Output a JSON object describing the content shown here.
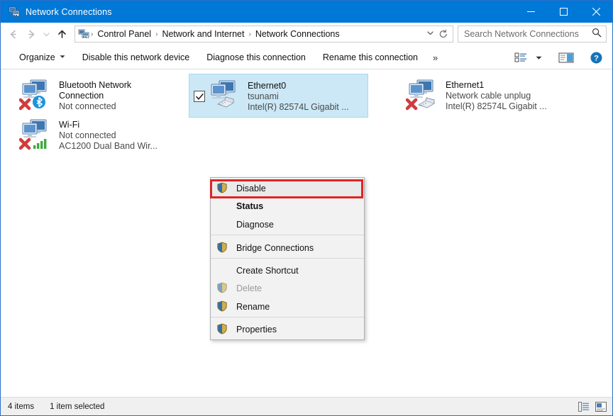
{
  "window": {
    "title": "Network Connections",
    "title_icon": "network-connections-icon",
    "minimize_label": "Minimize",
    "maximize_label": "Maximize",
    "close_label": "Close"
  },
  "nav": {
    "back_icon": "back-arrow-icon",
    "forward_icon": "forward-arrow-icon",
    "history_icon": "recent-locations-chevron-icon",
    "up_icon": "up-arrow-icon",
    "breadcrumb_icon": "control-panel-network-icon",
    "breadcrumbs": [
      {
        "label": "Control Panel"
      },
      {
        "label": "Network and Internet"
      },
      {
        "label": "Network Connections"
      }
    ],
    "separator": "›",
    "dropdown_icon": "chevron-down-icon",
    "refresh_icon": "refresh-icon"
  },
  "search": {
    "placeholder": "Search Network Connections",
    "icon": "search-icon"
  },
  "toolbar": {
    "items": [
      {
        "label": "Organize",
        "has_caret": true
      },
      {
        "label": "Disable this network device",
        "has_caret": false
      },
      {
        "label": "Diagnose this connection",
        "has_caret": false
      },
      {
        "label": "Rename this connection",
        "has_caret": false
      }
    ],
    "overflow_label": "»",
    "view_options_icon": "view-options-icon",
    "view_options_caret_icon": "chevron-down-icon",
    "preview_pane_icon": "preview-pane-icon",
    "help_icon": "help-icon"
  },
  "connections": [
    {
      "name": "Bluetooth Network Connection",
      "name_line1": "Bluetooth Network",
      "name_line2": "Connection",
      "status": "Not connected",
      "adapter": "",
      "icon": "network-adapter-icon",
      "overlay": "red-x-icon",
      "badge": "bluetooth-icon",
      "selected": false,
      "checked": false
    },
    {
      "name": "Wi-Fi",
      "name_line1": "Wi-Fi",
      "name_line2": "",
      "status": "Not connected",
      "adapter": "AC1200 Dual Band Wir...",
      "icon": "network-adapter-icon",
      "overlay": "red-x-icon",
      "badge": "wifi-signal-icon",
      "selected": false,
      "checked": false
    },
    {
      "name": "Ethernet0",
      "name_line1": "Ethernet0",
      "name_line2": "",
      "status": "tsunami",
      "adapter": "Intel(R) 82574L Gigabit ...",
      "icon": "network-adapter-icon",
      "overlay": "",
      "badge": "ethernet-cable-icon",
      "selected": true,
      "checked": true
    },
    {
      "name": "Ethernet1",
      "name_line1": "Ethernet1",
      "name_line2": "",
      "status": "Network cable unplug",
      "adapter": "Intel(R) 82574L Gigabit ...",
      "icon": "network-adapter-icon",
      "overlay": "red-x-icon",
      "badge": "ethernet-cable-icon",
      "selected": false,
      "checked": false
    }
  ],
  "context_menu": {
    "highlighted_item": "Disable",
    "highlight_color": "#e02424",
    "items": [
      {
        "label": "Disable",
        "shield": true,
        "bold": false,
        "disabled": false,
        "separator_after": false,
        "highlighted": true
      },
      {
        "label": "Status",
        "shield": false,
        "bold": true,
        "disabled": false,
        "separator_after": false,
        "highlighted": false
      },
      {
        "label": "Diagnose",
        "shield": false,
        "bold": false,
        "disabled": false,
        "separator_after": true,
        "highlighted": false
      },
      {
        "label": "Bridge Connections",
        "shield": true,
        "bold": false,
        "disabled": false,
        "separator_after": true,
        "highlighted": false
      },
      {
        "label": "Create Shortcut",
        "shield": false,
        "bold": false,
        "disabled": false,
        "separator_after": false,
        "highlighted": false
      },
      {
        "label": "Delete",
        "shield": true,
        "bold": false,
        "disabled": true,
        "separator_after": false,
        "highlighted": false
      },
      {
        "label": "Rename",
        "shield": true,
        "bold": false,
        "disabled": false,
        "separator_after": true,
        "highlighted": false
      },
      {
        "label": "Properties",
        "shield": true,
        "bold": false,
        "disabled": false,
        "separator_after": false,
        "highlighted": false
      }
    ]
  },
  "statusbar": {
    "item_count": "4 items",
    "selection": "1 item selected",
    "details_view_icon": "details-view-icon",
    "large_icons_view_icon": "large-icons-view-icon"
  },
  "colors": {
    "titlebar": "#0078d7",
    "selection": "#cce8f6",
    "highlight_red": "#e02424",
    "menu_bg": "#f2f2f2"
  }
}
